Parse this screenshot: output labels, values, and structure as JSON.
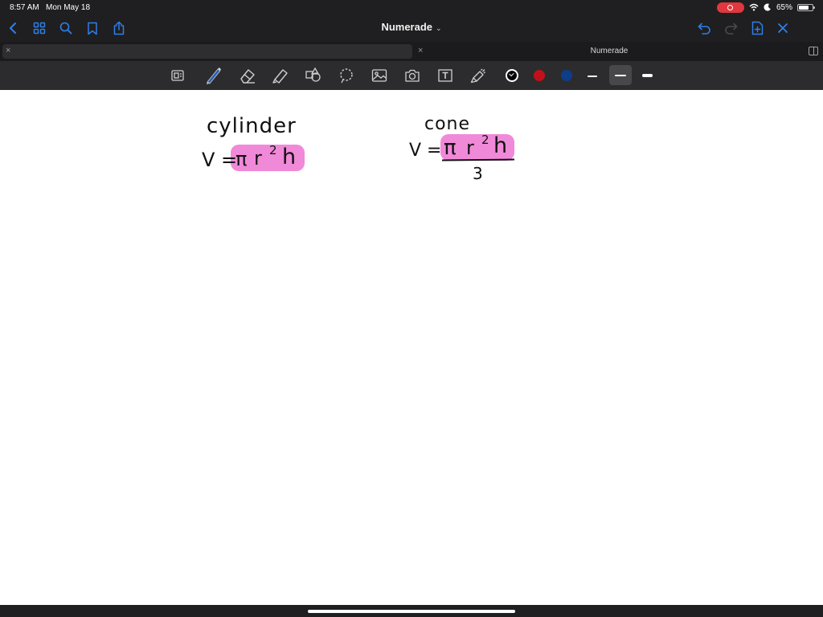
{
  "status": {
    "time": "8:57 AM",
    "date": "Mon May 18",
    "battery": "65%",
    "battery_level": 0.65,
    "icons": [
      "screen-record-icon",
      "wifi-icon",
      "moon-icon",
      "battery-icon"
    ],
    "record_color": "#e0383e"
  },
  "nav": {
    "title": "Numerade",
    "title_chevron": "⌄",
    "left_icons": [
      "back-chevron-icon",
      "grid-icon",
      "search-icon",
      "bookmark-icon",
      "share-icon"
    ],
    "right_icons": [
      "undo-icon",
      "redo-icon",
      "add-page-icon",
      "close-icon"
    ],
    "accent": "#2f7fe8"
  },
  "tabs": [
    {
      "label": "",
      "close": "×",
      "active": true
    },
    {
      "label": "Numerade",
      "close": "×",
      "active": false
    }
  ],
  "toolbar": {
    "tools": [
      "page-scan-icon",
      "pen-icon",
      "eraser-icon",
      "highlighter-icon",
      "shapes-icon",
      "lasso-icon",
      "image-icon",
      "camera-icon",
      "text-tool-icon",
      "laser-pointer-icon"
    ],
    "selected_tool": "pen-icon",
    "colors": [
      {
        "name": "black",
        "hex": "#000000",
        "selected": true
      },
      {
        "name": "red",
        "hex": "#c0111b",
        "selected": false
      },
      {
        "name": "blue",
        "hex": "#0f3d8a",
        "selected": false
      }
    ],
    "stroke_widths": [
      "thin",
      "medium",
      "thick"
    ],
    "selected_stroke": "medium"
  },
  "canvas": {
    "background": "#ffffff",
    "highlight_color": "#f07fd6",
    "notes": {
      "cylinder": {
        "heading": "cylinder",
        "lhs": "V =",
        "rhs_pi": "π",
        "rhs_r": "r",
        "rhs_exp": "2",
        "rhs_h": "h"
      },
      "cone": {
        "heading": "cone",
        "lhs": "V =",
        "rhs_pi": "π",
        "rhs_r": "r",
        "rhs_exp": "2",
        "rhs_h": "h",
        "denominator": "3"
      }
    }
  }
}
